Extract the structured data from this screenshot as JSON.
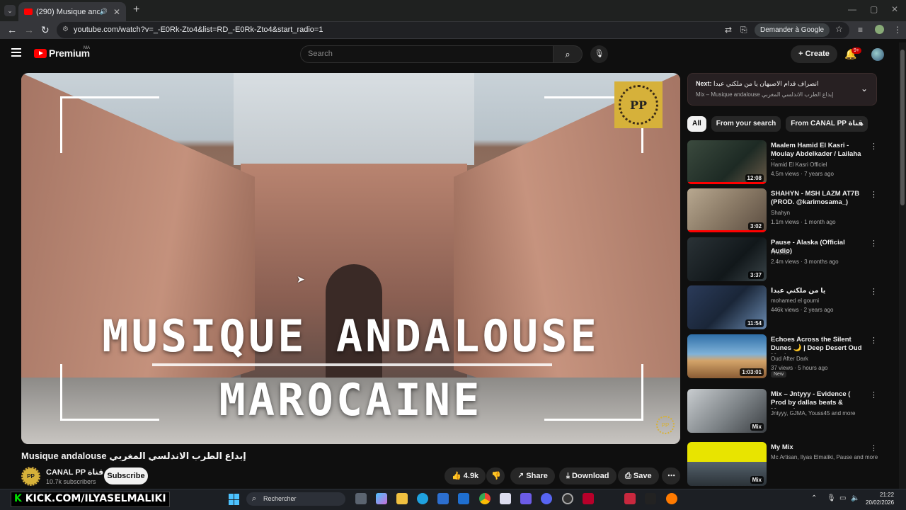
{
  "browser": {
    "tab_title": "(290) Musique andalouse ...",
    "url": "youtube.com/watch?v=_-E0Rk-Zto4&list=RD_-E0Rk-Zto4&start_radio=1",
    "ask_google": "Demander à Google"
  },
  "header": {
    "logo": "Premium",
    "country": "MA",
    "search_placeholder": "Search",
    "create": "Create",
    "notifications": "9+"
  },
  "player": {
    "title_line1": "MUSIQUE ANDALOUSE",
    "title_line2": "MAROCAINE",
    "badge": "PP",
    "watermark": "PP"
  },
  "video": {
    "title": "Musique andalouse إبداع الطرب الاندلسي المغربي",
    "channel": "CANAL PP قناة",
    "subscribers": "10.7k subscribers",
    "subscribe": "Subscribe",
    "likes": "4.9k",
    "share": "Share",
    "download": "Download",
    "save": "Save"
  },
  "next": {
    "label": "Next:",
    "title": "انصراف قدام الاصبهان يا من ملكني عبدا",
    "subtitle": "Mix – Musique andalouse إبداع الطرب الاندلسي المغربي"
  },
  "chips": [
    "All",
    "From your search",
    "From CANAL PP قناة"
  ],
  "recommendations": [
    {
      "title": "Maalem Hamid El Kasri - Moulay Abdelkader / Lailaha Il...",
      "channel": "Hamid El Kasri Officiel",
      "stats": "4.5m views · 7 years ago",
      "duration": "12:08",
      "progress": 1.0
    },
    {
      "title": "SHAHYN - MSH LAZM AT7B (PROD. @karimosama_)",
      "channel": "Shahyn",
      "stats": "1.1m views · 1 month ago",
      "duration": "3:02",
      "progress": 1.0
    },
    {
      "title": "Pause - Alaska (Official Audio)",
      "channel": "PAUSE",
      "stats": "2.4m views · 3 months ago",
      "duration": "3:37",
      "progress": 0
    },
    {
      "title": "يا من ملكني عبدا",
      "channel": "mohamed el goumi",
      "stats": "446k views · 2 years ago",
      "duration": "11:54",
      "progress": 0
    },
    {
      "title": "Echoes Across the Silent Dunes 🌙 | Deep Desert Oud Music",
      "channel": "Oud After Dark",
      "stats": "37 views · 5 hours ago",
      "duration": "1:03:01",
      "badge": "New",
      "progress": 0
    },
    {
      "title": "Mix – Jntyyy - Evidence ( Prod by dallas beats & Mynex )",
      "channel": "Jntyyy, GJMA, Youss45 and more",
      "stats": "",
      "duration": "Mix",
      "progress": 0
    },
    {
      "title": "My Mix",
      "channel": "Mc Artisan, Ilyas Elmaliki, Pause and more",
      "stats": "",
      "duration": "Mix",
      "progress": 0
    }
  ],
  "taskbar": {
    "overlay_k": "K",
    "overlay_text": "KICK.COM/ILYASELMALIKI",
    "search": "Rechercher",
    "time": "21:22",
    "date": "20/02/2026"
  },
  "colors": {
    "accent": "#ff0000",
    "background": "#0f0f0f",
    "chip_bg": "#272727"
  }
}
